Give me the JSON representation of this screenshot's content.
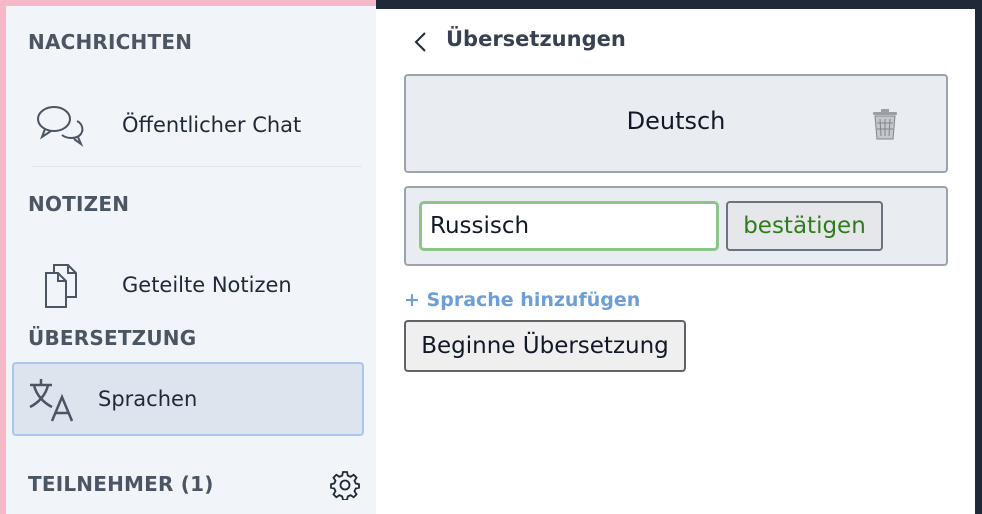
{
  "sidebar": {
    "sections": {
      "chat_title": "NACHRICHTEN",
      "notes_title": "NOTIZEN",
      "translation_title": "ÜBERSETZUNG",
      "users_title": "TEILNEHMER (1)"
    },
    "items": {
      "chat": {
        "label": "Öffentlicher Chat",
        "icon": "chat-bubbles-icon"
      },
      "notes": {
        "label": "Geteilte Notizen",
        "icon": "documents-icon"
      },
      "languages": {
        "label": "Sprachen",
        "icon": "translate-icon",
        "active": true
      }
    },
    "users_settings_icon": "gear-icon"
  },
  "panel": {
    "title": "Übersetzungen",
    "back_icon": "chevron-left-icon",
    "language_entry": {
      "name": "Deutsch",
      "delete_icon": "trash-icon"
    },
    "new_language": {
      "input_value": "Russisch",
      "confirm_label": "bestätigen"
    },
    "add_language_link": "+ Sprache hinzufügen",
    "begin_button": "Beginne Übersetzung"
  },
  "colors": {
    "sidebar_bg": "#f1f4f8",
    "active_item_bg": "#dde4ee",
    "active_item_border": "#a7c7ec",
    "confirm_text": "#2f7d1a",
    "input_border": "#8bc58a",
    "link": "#6d9fd6",
    "frame_pink": "#f6b8c6",
    "frame_dark": "#1f2937"
  }
}
